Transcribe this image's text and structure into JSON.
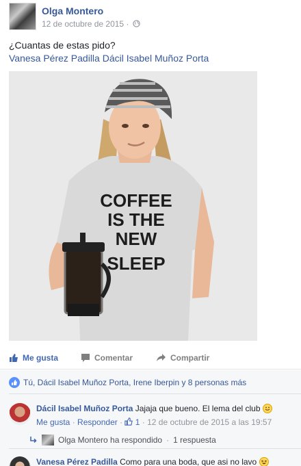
{
  "post": {
    "author": "Olga Montero",
    "date": "12 de octubre de 2015",
    "meta_sep": " · ",
    "text": "¿Cuantas de estas pido?",
    "tags": "Vanesa Pérez Padilla Dácil Isabel Muñoz Porta",
    "photo_text": [
      "COFFEE",
      "IS THE",
      "NEW",
      "SLEEP"
    ]
  },
  "actions": {
    "like": "Me gusta",
    "comment": "Comentar",
    "share": "Compartir"
  },
  "likes_summary": "Tú, Dácil Isabel Muñoz Porta, Irene Iberpin y 8 personas más",
  "comments": [
    {
      "name": "Dácil Isabel Muñoz Porta",
      "text": "Jajaja que bueno. El lema del club",
      "like": "Me gusta",
      "reply": "Responder",
      "like_count": "1",
      "timestamp": "12 de octubre de 2015 a las 19:57",
      "replies_line": "Olga Montero ha respondido",
      "replies_count": "1 respuesta"
    },
    {
      "name": "Vanesa Pérez Padilla",
      "text": "Como para una boda, que asi no lavo"
    }
  ],
  "colors": {
    "link": "#365899",
    "action_blue": "#4267b2",
    "muted": "#90949c",
    "feedback_bg": "#f6f7f9"
  }
}
